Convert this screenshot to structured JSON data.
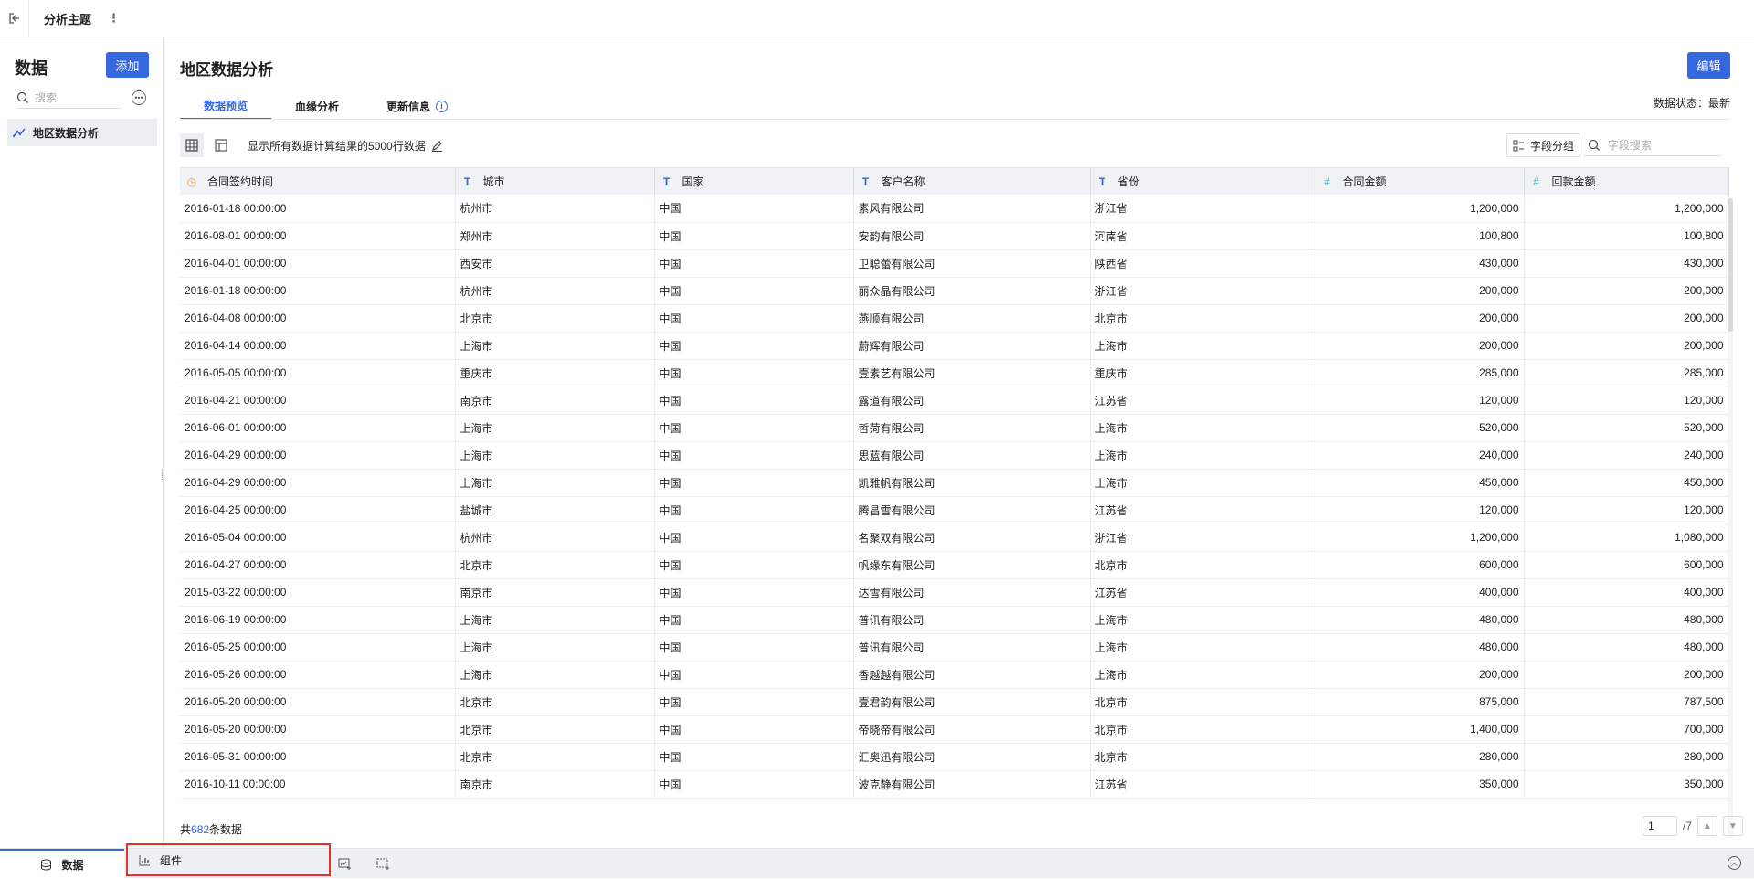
{
  "topbar": {
    "tab_label": "分析主题",
    "more_symbol": "⋮"
  },
  "sidebar": {
    "title": "数据",
    "add_label": "添加",
    "search_placeholder": "搜索",
    "items": [
      {
        "label": "地区数据分析",
        "icon": "line-chart-icon"
      }
    ]
  },
  "main": {
    "title": "地区数据分析",
    "edit_label": "编辑",
    "tabs": [
      {
        "label": "数据预览",
        "active": true
      },
      {
        "label": "血缘分析",
        "active": false
      },
      {
        "label": "更新信息",
        "active": false
      }
    ],
    "status": "数据状态：最新",
    "hint": "显示所有数据计算结果的5000行数据",
    "group_label": "字段分组",
    "field_search_placeholder": "字段搜索",
    "accent_color": "#3467e0"
  },
  "table": {
    "columns": [
      {
        "label": "合同签约时间",
        "type": "date"
      },
      {
        "label": "城市",
        "type": "text"
      },
      {
        "label": "国家",
        "type": "text"
      },
      {
        "label": "客户名称",
        "type": "text"
      },
      {
        "label": "省份",
        "type": "text"
      },
      {
        "label": "合同金额",
        "type": "number"
      },
      {
        "label": "回款金额",
        "type": "number"
      }
    ],
    "rows": [
      [
        "2016-01-18 00:00:00",
        "杭州市",
        "中国",
        "素风有限公司",
        "浙江省",
        "1,200,000",
        "1,200,000"
      ],
      [
        "2016-08-01 00:00:00",
        "郑州市",
        "中国",
        "安韵有限公司",
        "河南省",
        "100,800",
        "100,800"
      ],
      [
        "2016-04-01 00:00:00",
        "西安市",
        "中国",
        "卫聪蕾有限公司",
        "陕西省",
        "430,000",
        "430,000"
      ],
      [
        "2016-01-18 00:00:00",
        "杭州市",
        "中国",
        "丽众晶有限公司",
        "浙江省",
        "200,000",
        "200,000"
      ],
      [
        "2016-04-08 00:00:00",
        "北京市",
        "中国",
        "燕顺有限公司",
        "北京市",
        "200,000",
        "200,000"
      ],
      [
        "2016-04-14 00:00:00",
        "上海市",
        "中国",
        "蔚辉有限公司",
        "上海市",
        "200,000",
        "200,000"
      ],
      [
        "2016-05-05 00:00:00",
        "重庆市",
        "中国",
        "壹素艺有限公司",
        "重庆市",
        "285,000",
        "285,000"
      ],
      [
        "2016-04-21 00:00:00",
        "南京市",
        "中国",
        "露道有限公司",
        "江苏省",
        "120,000",
        "120,000"
      ],
      [
        "2016-06-01 00:00:00",
        "上海市",
        "中国",
        "哲菏有限公司",
        "上海市",
        "520,000",
        "520,000"
      ],
      [
        "2016-04-29 00:00:00",
        "上海市",
        "中国",
        "思蓝有限公司",
        "上海市",
        "240,000",
        "240,000"
      ],
      [
        "2016-04-29 00:00:00",
        "上海市",
        "中国",
        "凯雅帆有限公司",
        "上海市",
        "450,000",
        "450,000"
      ],
      [
        "2016-04-25 00:00:00",
        "盐城市",
        "中国",
        "腾昌雪有限公司",
        "江苏省",
        "120,000",
        "120,000"
      ],
      [
        "2016-05-04 00:00:00",
        "杭州市",
        "中国",
        "名聚双有限公司",
        "浙江省",
        "1,200,000",
        "1,080,000"
      ],
      [
        "2016-04-27 00:00:00",
        "北京市",
        "中国",
        "帆缘东有限公司",
        "北京市",
        "600,000",
        "600,000"
      ],
      [
        "2015-03-22 00:00:00",
        "南京市",
        "中国",
        "达雪有限公司",
        "江苏省",
        "400,000",
        "400,000"
      ],
      [
        "2016-06-19 00:00:00",
        "上海市",
        "中国",
        "普讯有限公司",
        "上海市",
        "480,000",
        "480,000"
      ],
      [
        "2016-05-25 00:00:00",
        "上海市",
        "中国",
        "普讯有限公司",
        "上海市",
        "480,000",
        "480,000"
      ],
      [
        "2016-05-26 00:00:00",
        "上海市",
        "中国",
        "香越越有限公司",
        "上海市",
        "200,000",
        "200,000"
      ],
      [
        "2016-05-20 00:00:00",
        "北京市",
        "中国",
        "壹君韵有限公司",
        "北京市",
        "875,000",
        "787,500"
      ],
      [
        "2016-05-20 00:00:00",
        "北京市",
        "中国",
        "帝晓帝有限公司",
        "北京市",
        "1,400,000",
        "700,000"
      ],
      [
        "2016-05-31 00:00:00",
        "北京市",
        "中国",
        "汇奥迅有限公司",
        "北京市",
        "280,000",
        "280,000"
      ],
      [
        "2016-10-11 00:00:00",
        "南京市",
        "中国",
        "波克静有限公司",
        "江苏省",
        "350,000",
        "350,000"
      ]
    ]
  },
  "footer": {
    "count_prefix": "共",
    "count": "682",
    "count_suffix": "条数据",
    "page": "1",
    "total_pages": "/7"
  },
  "bottombar": {
    "data_tab": "数据",
    "component_tab": "组件"
  }
}
